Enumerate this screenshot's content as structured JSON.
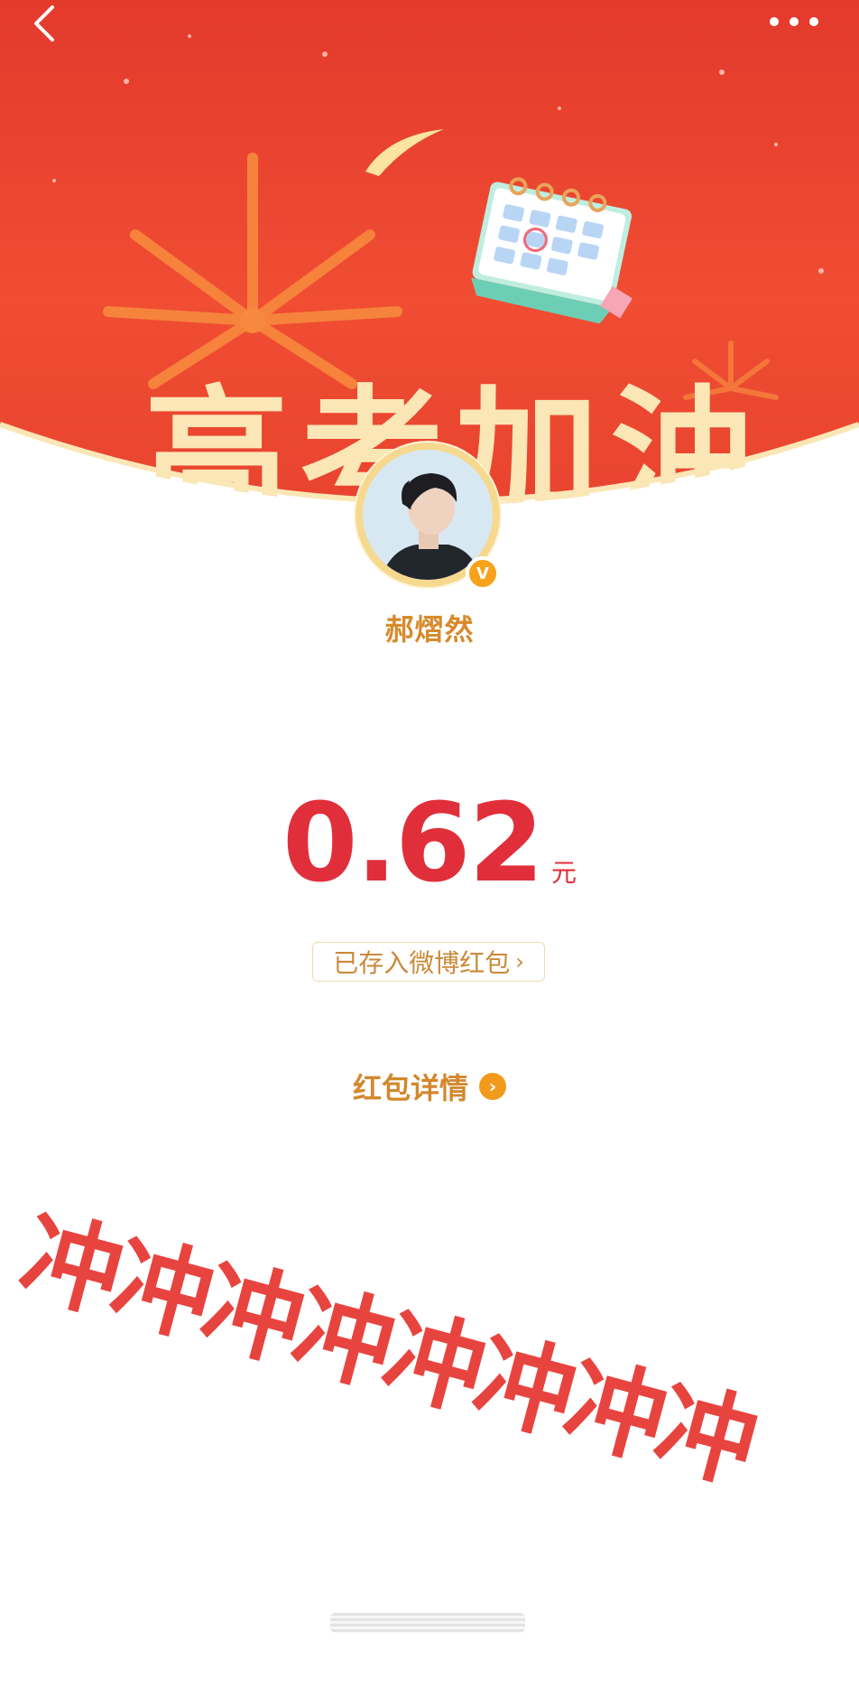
{
  "header": {
    "banner_text": "高考加油",
    "back_icon": "back-arrow-icon",
    "more_icon": "more-dots-icon"
  },
  "user": {
    "name": "郝熠然",
    "verified_badge": "V"
  },
  "red_packet": {
    "amount": "0.62",
    "unit": "元",
    "saved_label": "已存入微博红包",
    "detail_label": "红包详情"
  },
  "overlay": {
    "text": "冲冲冲冲冲冲冲冲"
  },
  "colors": {
    "banner_red": "#e8442f",
    "amount_red": "#e02f3b",
    "gold": "#d78a2c"
  }
}
